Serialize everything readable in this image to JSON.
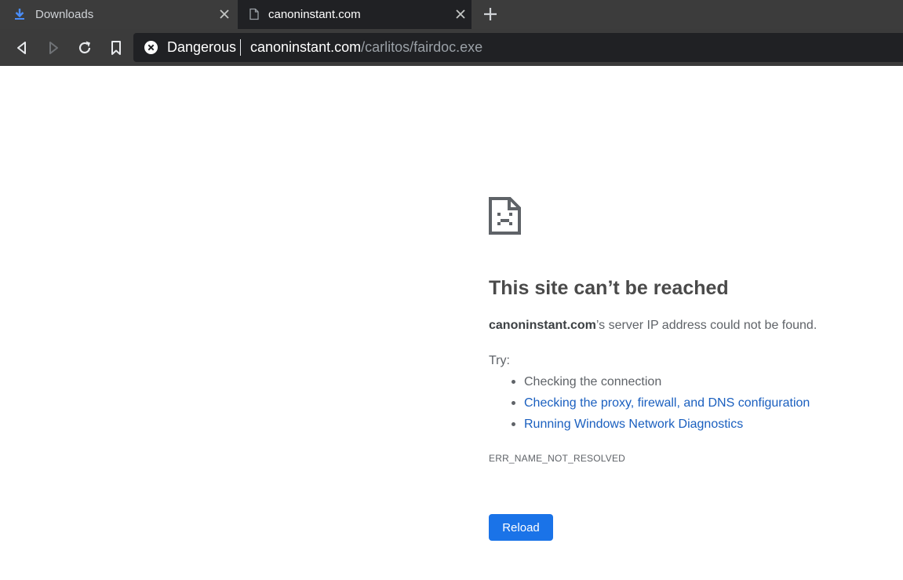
{
  "tabs": [
    {
      "title": "Downloads",
      "icon": "download-icon",
      "active": false
    },
    {
      "title": "canoninstant.com",
      "icon": "page-icon",
      "active": true
    }
  ],
  "toolbar": {
    "security_label": "Dangerous",
    "url_host": "canoninstant.com",
    "url_path": "/carlitos/fairdoc.exe"
  },
  "error_page": {
    "heading": "This site can’t be reached",
    "host": "canoninstant.com",
    "description_suffix": "’s server IP address could not be found.",
    "try_label": "Try:",
    "suggestions": [
      {
        "text": "Checking the connection",
        "link": false
      },
      {
        "text": "Checking the proxy, firewall, and DNS configuration",
        "link": true
      },
      {
        "text": "Running Windows Network Diagnostics",
        "link": true
      }
    ],
    "error_code": "ERR_NAME_NOT_RESOLVED",
    "reload_label": "Reload"
  },
  "colors": {
    "tab_strip": "#3c3c3c",
    "active_tab": "#202124",
    "link": "#1a5fbf",
    "primary_button": "#1a73e8",
    "download_icon": "#4a8df8"
  }
}
